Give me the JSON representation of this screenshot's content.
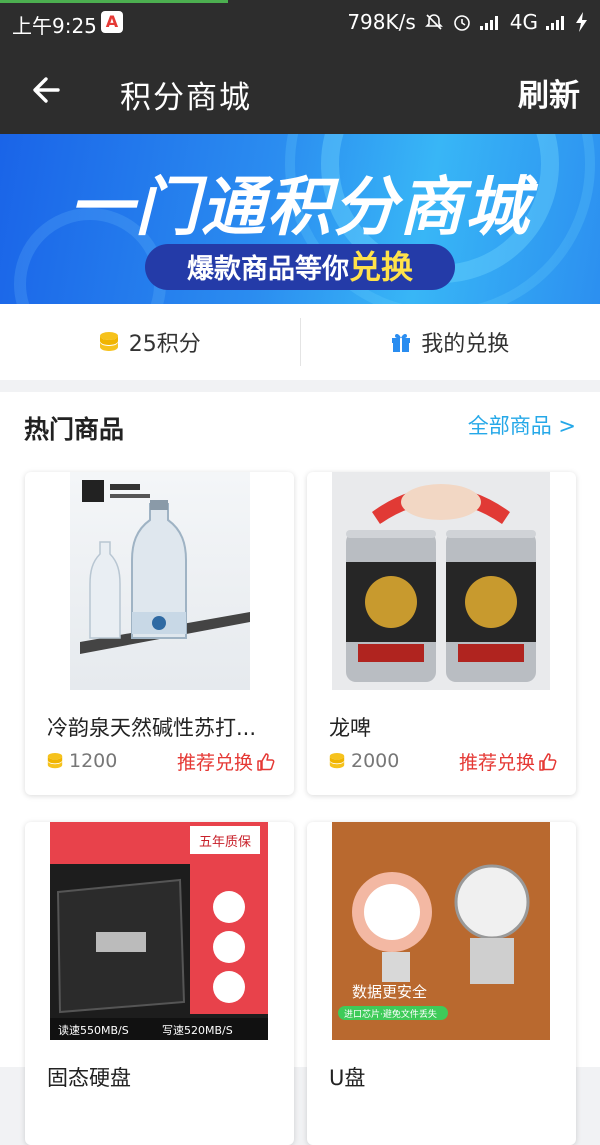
{
  "status_bar": {
    "time": "上午9:25",
    "app_icon_letter": "A",
    "network_speed": "798K/s",
    "network_type": "4G"
  },
  "header": {
    "title": "积分商城",
    "refresh_label": "刷新"
  },
  "banner": {
    "title": "一门通积分商城",
    "subtitle_prefix": "爆款商品等你",
    "subtitle_highlight": "兑换"
  },
  "points_bar": {
    "points_label": "25积分",
    "my_redeem_label": "我的兑换"
  },
  "hot_section": {
    "title": "热门商品",
    "all_link": "全部商品 >"
  },
  "products": [
    {
      "name": "冷韵泉天然碱性苏打...",
      "price": "1200",
      "redeem_label": "推荐兑换"
    },
    {
      "name": "龙啤",
      "price": "2000",
      "redeem_label": "推荐兑换"
    },
    {
      "name": "固态硬盘",
      "image_text": [
        "五年质保",
        "读速550MB/S",
        "写速520MB/S"
      ]
    },
    {
      "name": "U盘",
      "image_text": [
        "数据更安全",
        "进口芯片·避免文件丢失"
      ]
    }
  ],
  "colors": {
    "accent_blue": "#25a8e8",
    "redeem_red": "#e53935",
    "coin_yellow": "#f6c21c",
    "gift_blue": "#2a8df0"
  }
}
